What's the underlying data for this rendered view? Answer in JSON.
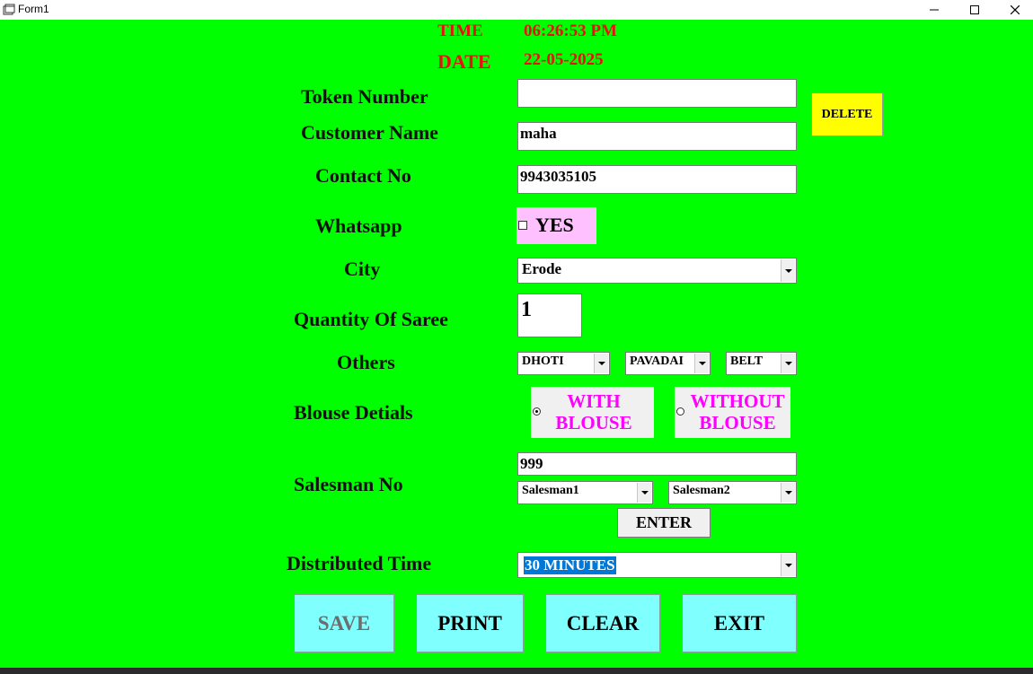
{
  "window": {
    "title": "Form1",
    "icon": "form-window-icon",
    "controls": [
      "minimize-icon",
      "maximize-icon",
      "close-icon"
    ]
  },
  "header": {
    "time_label": "TIME",
    "time_value": "06:26:53 PM",
    "date_label": "DATE",
    "date_value": "22-05-2025"
  },
  "form": {
    "token_label": "Token Number",
    "token_value": "",
    "delete_label": "DELETE",
    "customer_label": "Customer Name",
    "customer_value": "maha",
    "contact_label": "Contact No",
    "contact_value": "9943035105",
    "whatsapp_label": "Whatsapp",
    "whatsapp_checkbox_label": "YES",
    "whatsapp_checked": false,
    "city_label": "City",
    "city_value": "Erode",
    "quantity_label": "Quantity Of Saree",
    "quantity_value": "1",
    "others_label": "Others",
    "others_dropdowns": [
      "DHOTI",
      "PAVADAI",
      "BELT"
    ],
    "blouse_label": "Blouse Detials",
    "blouse_with_line1": "WITH",
    "blouse_with_line2": "BLOUSE",
    "blouse_without_line1": "WITHOUT",
    "blouse_without_line2": "BLOUSE",
    "blouse_selected": "WITH BLOUSE",
    "salesman_label": "Salesman No",
    "salesman_value": "999",
    "salesman1": "Salesman1",
    "salesman2": "Salesman2",
    "enter_label": "ENTER",
    "distributed_label": "Distributed Time",
    "distributed_value": "30 MINUTES"
  },
  "actions": {
    "save": "SAVE",
    "print": "PRINT",
    "clear": "CLEAR",
    "exit": "EXIT"
  },
  "colors": {
    "background": "#00ff00",
    "header_text": "#e81010",
    "delete_button": "#ffff00",
    "whatsapp_box": "#ffc0ff",
    "radio_text": "#ff00ff",
    "action_button": "#80ffff",
    "selection": "#0078d7",
    "disabled_text": "#6d6d6d"
  }
}
